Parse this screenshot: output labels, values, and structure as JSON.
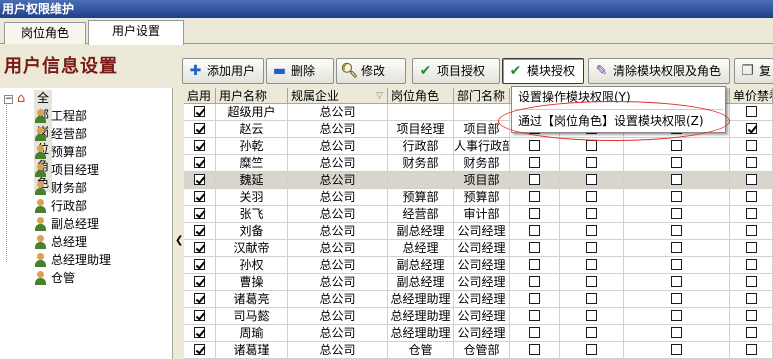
{
  "window": {
    "title": "用户权限维护"
  },
  "tabs": [
    {
      "label": "岗位角色",
      "active": false
    },
    {
      "label": "用户设置",
      "active": true
    }
  ],
  "heading": "用户信息设置",
  "toolbar": {
    "buttons": [
      {
        "label": "添加用户",
        "icon": "plus-icon"
      },
      {
        "label": "删除",
        "icon": "minus-icon"
      },
      {
        "label": "修改",
        "icon": "magnifier-icon"
      },
      {
        "label": "项目授权",
        "icon": "check-icon"
      },
      {
        "label": "模块授权",
        "icon": "check-icon",
        "pressed": true
      },
      {
        "label": "清除模块权限及角色",
        "icon": "wand-icon"
      },
      {
        "label": "复",
        "icon": "copy-icon"
      }
    ]
  },
  "tree": {
    "root": "全部岗位角色",
    "items": [
      "工程部",
      "经营部",
      "预算部",
      "项目经理",
      "财务部",
      "行政部",
      "副总经理",
      "总经理",
      "总经理助理",
      "仓管"
    ]
  },
  "grid": {
    "columns": [
      "启用",
      "用户名称",
      "规属企业",
      "岗位角色",
      "部门名称",
      "单价禁看"
    ],
    "rows": [
      {
        "enabled": true,
        "name": "超级用户",
        "company": "总公司",
        "role": "",
        "dept": "",
        "c1": false,
        "c2": false,
        "c3": false,
        "c4": false,
        "selected": false
      },
      {
        "enabled": true,
        "name": "赵云",
        "company": "总公司",
        "role": "项目经理",
        "dept": "项目部",
        "c1": false,
        "c2": false,
        "c3": false,
        "c4": true,
        "selected": false
      },
      {
        "enabled": true,
        "name": "孙乾",
        "company": "总公司",
        "role": "行政部",
        "dept": "人事行政部",
        "c1": false,
        "c2": false,
        "c3": false,
        "c4": false,
        "selected": false
      },
      {
        "enabled": true,
        "name": "糜竺",
        "company": "总公司",
        "role": "财务部",
        "dept": "财务部",
        "c1": false,
        "c2": false,
        "c3": false,
        "c4": false,
        "selected": false
      },
      {
        "enabled": true,
        "name": "魏延",
        "company": "总公司",
        "role": "",
        "dept": "项目部",
        "c1": false,
        "c2": false,
        "c3": false,
        "c4": false,
        "selected": true
      },
      {
        "enabled": true,
        "name": "关羽",
        "company": "总公司",
        "role": "预算部",
        "dept": "预算部",
        "c1": false,
        "c2": false,
        "c3": false,
        "c4": false,
        "selected": false
      },
      {
        "enabled": true,
        "name": "张飞",
        "company": "总公司",
        "role": "经营部",
        "dept": "审计部",
        "c1": false,
        "c2": false,
        "c3": false,
        "c4": false,
        "selected": false
      },
      {
        "enabled": true,
        "name": "刘备",
        "company": "总公司",
        "role": "副总经理",
        "dept": "公司经理",
        "c1": false,
        "c2": false,
        "c3": false,
        "c4": false,
        "selected": false
      },
      {
        "enabled": true,
        "name": "汉献帝",
        "company": "总公司",
        "role": "总经理",
        "dept": "公司经理",
        "c1": false,
        "c2": false,
        "c3": false,
        "c4": false,
        "selected": false
      },
      {
        "enabled": true,
        "name": "孙权",
        "company": "总公司",
        "role": "副总经理",
        "dept": "公司经理",
        "c1": false,
        "c2": false,
        "c3": false,
        "c4": false,
        "selected": false
      },
      {
        "enabled": true,
        "name": "曹操",
        "company": "总公司",
        "role": "副总经理",
        "dept": "公司经理",
        "c1": false,
        "c2": false,
        "c3": false,
        "c4": false,
        "selected": false
      },
      {
        "enabled": true,
        "name": "诸葛亮",
        "company": "总公司",
        "role": "总经理助理",
        "dept": "公司经理",
        "c1": false,
        "c2": false,
        "c3": false,
        "c4": false,
        "selected": false
      },
      {
        "enabled": true,
        "name": "司马懿",
        "company": "总公司",
        "role": "总经理助理",
        "dept": "公司经理",
        "c1": false,
        "c2": false,
        "c3": false,
        "c4": false,
        "selected": false
      },
      {
        "enabled": true,
        "name": "周瑜",
        "company": "总公司",
        "role": "总经理助理",
        "dept": "公司经理",
        "c1": false,
        "c2": false,
        "c3": false,
        "c4": false,
        "selected": false
      },
      {
        "enabled": true,
        "name": "诸葛瑾",
        "company": "总公司",
        "role": "仓管",
        "dept": "仓管部",
        "c1": false,
        "c2": false,
        "c3": false,
        "c4": false,
        "selected": false
      }
    ]
  },
  "menu": {
    "items": [
      "设置操作模块权限(Y)",
      "通过【岗位角色】设置模块权限(Z)"
    ]
  },
  "colors": {
    "title_bar": "#1e3f8c",
    "heading": "#7a1a16",
    "highlight_ellipse": "#e0302a"
  }
}
